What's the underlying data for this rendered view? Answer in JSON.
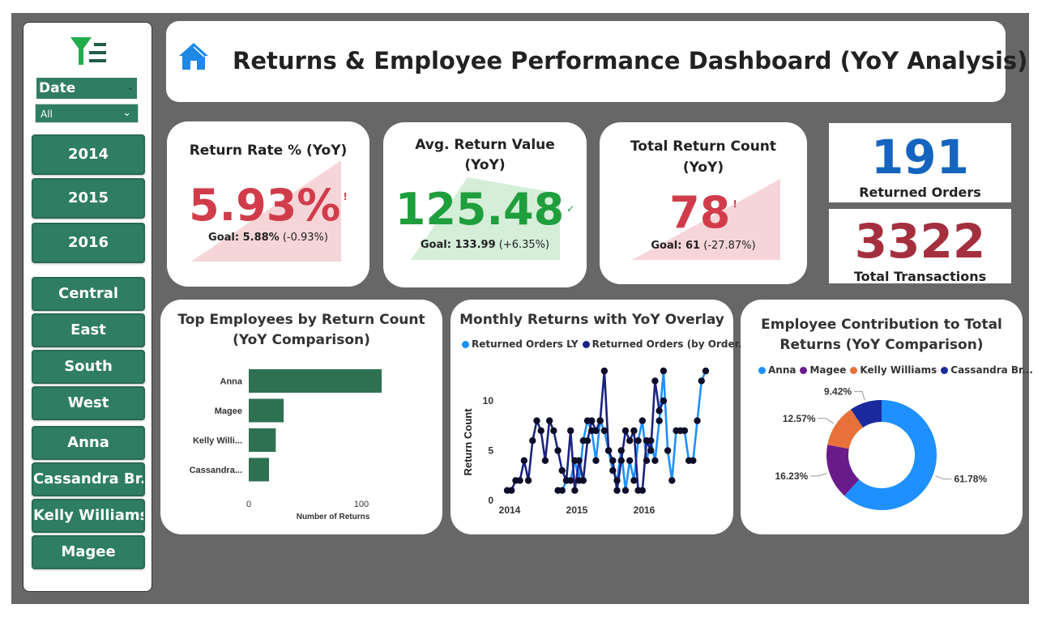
{
  "header": {
    "title": "Returns & Employee Performance Dashboard (YoY Analysis)"
  },
  "sidebar": {
    "date_label": "Date",
    "date_value": "All",
    "years": [
      "2014",
      "2015",
      "2016"
    ],
    "regions": [
      "Central",
      "East",
      "South",
      "West"
    ],
    "employees": [
      "Anna",
      "Cassandra Br...",
      "Kelly Williams",
      "Magee"
    ]
  },
  "kpis": {
    "return_rate": {
      "title": "Return Rate % (YoY)",
      "value": "5.93%",
      "goal_label": "Goal: 5.88%",
      "goal_delta": "(-0.93%)",
      "mark": "!",
      "color": "#d13c4b"
    },
    "avg_value": {
      "title_line1": "Avg. Return Value",
      "title_line2": "(YoY)",
      "value": "125.48",
      "goal_label": "Goal: 133.99",
      "goal_delta": "(+6.35%)",
      "mark": "✓",
      "color": "#1f9e3d"
    },
    "total_count": {
      "title_line1": "Total Return Count",
      "title_line2": "(YoY)",
      "value": "78",
      "goal_label": "Goal: 61",
      "goal_delta": "(-27.87%)",
      "mark": "!",
      "color": "#d13c4b"
    }
  },
  "stats": {
    "returned_orders": {
      "value": "191",
      "label": "Returned Orders",
      "color": "#1565c0"
    },
    "total_transactions": {
      "value": "3322",
      "label": "Total Transactions",
      "color": "#a4303f"
    }
  },
  "chart_data": [
    {
      "type": "bar",
      "title_line1": "Top Employees by Return Count",
      "title_line2": "(YoY Comparison)",
      "categories": [
        "Anna",
        "Magee",
        "Kelly Willi...",
        "Cassandra..."
      ],
      "values": [
        118,
        31,
        24,
        18
      ],
      "xlabel": "Number of Returns",
      "xticks": [
        "0",
        "100"
      ],
      "xlim": [
        0,
        130
      ],
      "color": "#2e7151"
    },
    {
      "type": "line",
      "title": "Monthly Returns with YoY Overlay",
      "ylabel": "Return Count",
      "yticks": [
        "0",
        "5",
        "10"
      ],
      "ylim": [
        0,
        14
      ],
      "xticks": [
        "2014",
        "2015",
        "2016"
      ],
      "series": [
        {
          "name": "Returned Orders LY",
          "color": "#1e90ff",
          "values": [
            null,
            null,
            null,
            null,
            null,
            null,
            null,
            null,
            null,
            null,
            null,
            null,
            1,
            1,
            2,
            2,
            4,
            2,
            6,
            8,
            7,
            4,
            8,
            7,
            5,
            3,
            2,
            5,
            1,
            4,
            2,
            6,
            8,
            4,
            6,
            4,
            8,
            13,
            5,
            2,
            7,
            7,
            7,
            4,
            4,
            8,
            12,
            13
          ]
        },
        {
          "name": "Returned Orders (by Order...",
          "color": "#1a237e",
          "values": [
            1,
            1,
            2,
            2,
            4,
            2,
            6,
            8,
            7,
            4,
            8,
            7,
            5,
            3,
            2,
            7,
            1,
            4,
            2,
            6,
            8,
            7,
            8,
            13,
            5,
            4,
            1,
            4,
            7,
            6,
            7,
            1,
            1,
            6,
            5,
            12,
            9,
            10,
            null,
            null,
            null,
            null,
            null,
            null,
            null,
            null,
            null,
            null
          ]
        }
      ],
      "start_label": "2014"
    },
    {
      "type": "pie",
      "title_line1": "Employee Contribution to Total",
      "title_line2": "Returns (YoY Comparison)",
      "slices": [
        {
          "label": "Anna",
          "value": 61.78,
          "pct": "61.78%",
          "color": "#1e90ff"
        },
        {
          "label": "Magee",
          "value": 16.23,
          "pct": "16.23%",
          "color": "#6a1b8a"
        },
        {
          "label": "Kelly Williams",
          "value": 12.57,
          "pct": "12.57%",
          "color": "#e8713a"
        },
        {
          "label": "Cassandra Br...",
          "value": 9.42,
          "pct": "9.42%",
          "color": "#1a2a9e"
        }
      ]
    }
  ]
}
